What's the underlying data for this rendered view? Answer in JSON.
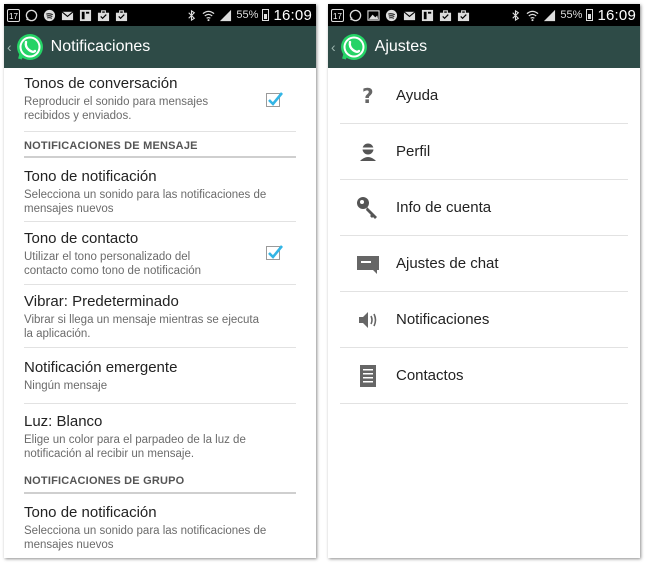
{
  "status_bar": {
    "left_calendar_day": "17",
    "battery_percent": "55%",
    "time": "16:09",
    "icons": [
      "calendar-icon",
      "whatsapp-icon",
      "spotify-icon",
      "gmail-icon",
      "news-icon",
      "briefcase-icon",
      "briefcase-icon",
      "bluetooth-icon",
      "wifi-icon",
      "signal-icon",
      "battery-icon"
    ]
  },
  "left_screen": {
    "title": "Notificaciones",
    "items": [
      {
        "title": "Tonos de conversación",
        "summary": "Reproducir el sonido para mensajes recibidos y enviados.",
        "checked": true
      },
      {
        "section": "NOTIFICACIONES DE MENSAJE"
      },
      {
        "title": "Tono de notificación",
        "summary": "Selecciona un sonido para las notificaciones de mensajes nuevos"
      },
      {
        "title": "Tono de contacto",
        "summary": "Utilizar el tono personalizado del contacto como tono de notificación",
        "checked": true
      },
      {
        "title": "Vibrar: Predeterminado",
        "summary": "Vibrar si llega un mensaje mientras se ejecuta la aplicación."
      },
      {
        "title": "Notificación emergente",
        "summary": "Ningún mensaje"
      },
      {
        "title": "Luz: Blanco",
        "summary": "Elige un color para el parpadeo de la luz de notificación al recibir un mensaje."
      },
      {
        "section": "NOTIFICACIONES DE GRUPO"
      },
      {
        "title": "Tono de notificación",
        "summary": "Selecciona un sonido para las notificaciones de mensajes nuevos"
      }
    ]
  },
  "right_screen": {
    "title": "Ajustes",
    "menu": [
      {
        "label": "Ayuda",
        "icon": "help-icon"
      },
      {
        "label": "Perfil",
        "icon": "profile-icon"
      },
      {
        "label": "Info de cuenta",
        "icon": "key-icon"
      },
      {
        "label": "Ajustes de chat",
        "icon": "chat-icon"
      },
      {
        "label": "Notificaciones",
        "icon": "speaker-icon"
      },
      {
        "label": "Contactos",
        "icon": "contacts-icon"
      }
    ]
  },
  "colors": {
    "action_bar": "#2e4b47",
    "checkbox_check": "#33b5e5",
    "whatsapp_green": "#25d366"
  }
}
